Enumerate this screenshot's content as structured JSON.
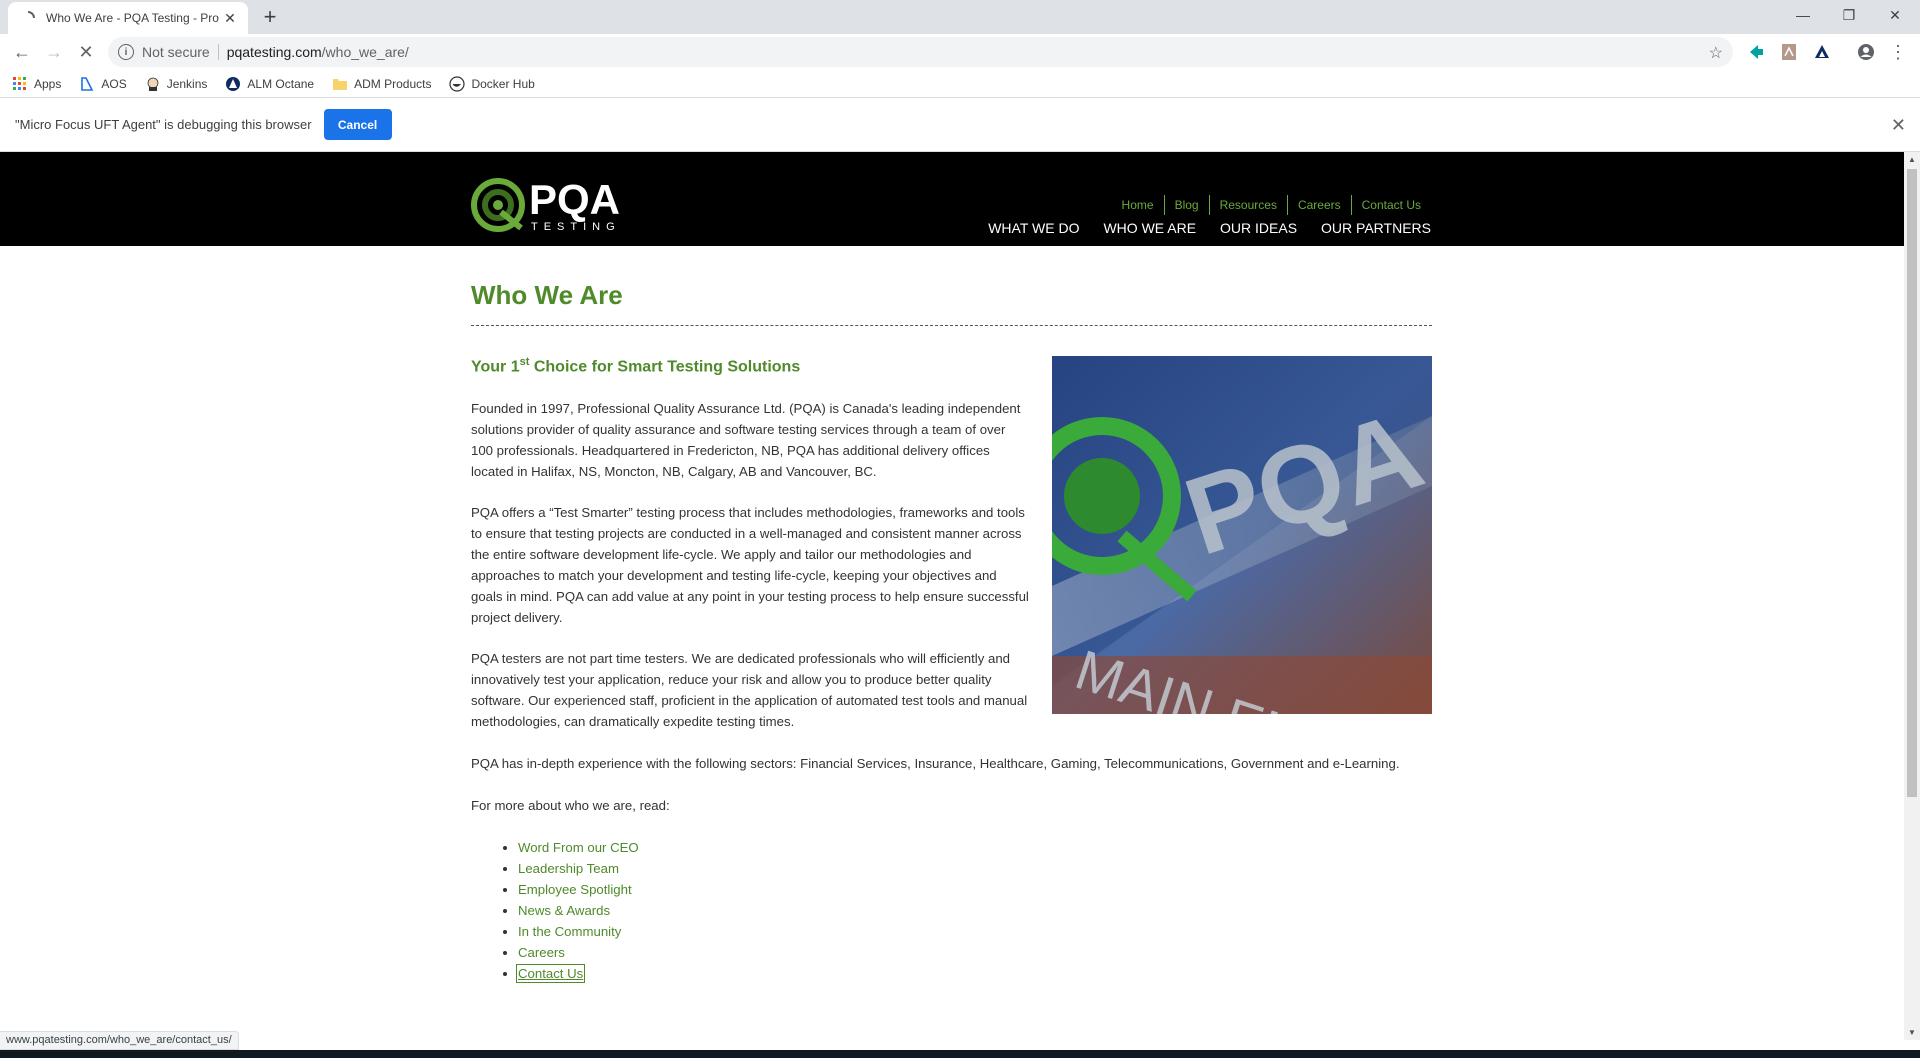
{
  "browser": {
    "tab_title": "Who We Are - PQA Testing - Pro",
    "security_label": "Not secure",
    "url_host": "pqatesting.com",
    "url_path": "/who_we_are/",
    "bookmarks": [
      {
        "label": "Apps",
        "icon": "apps-grid-icon"
      },
      {
        "label": "AOS",
        "icon": "aos-icon"
      },
      {
        "label": "Jenkins",
        "icon": "jenkins-icon"
      },
      {
        "label": "ALM Octane",
        "icon": "alm-octane-icon"
      },
      {
        "label": "ADM Products",
        "icon": "folder-icon"
      },
      {
        "label": "Docker Hub",
        "icon": "docker-icon"
      }
    ],
    "infobar_message": "\"Micro Focus UFT Agent\" is debugging this browser",
    "infobar_cancel": "Cancel",
    "status_url": "www.pqatesting.com/who_we_are/contact_us/"
  },
  "site": {
    "logo_text": "PQA",
    "logo_subtext": "TESTING",
    "util_nav": [
      "Home",
      "Blog",
      "Resources",
      "Careers",
      "Contact Us"
    ],
    "main_nav": [
      "WHAT WE DO",
      "WHO WE ARE",
      "OUR IDEAS",
      "OUR PARTNERS"
    ],
    "accent_color": "#4f8a2b"
  },
  "content": {
    "title": "Who We Are",
    "subtitle_pre": "Your 1",
    "subtitle_sup": "st",
    "subtitle_post": " Choice for Smart Testing Solutions",
    "paragraphs": [
      "Founded in 1997, Professional Quality Assurance Ltd. (PQA) is Canada's leading independent solutions provider of quality assurance and software testing services through a team of over 100 professionals. Headquartered in Fredericton, NB, PQA has additional delivery offices located in Halifax, NS, Moncton, NB, Calgary, AB and Vancouver, BC.",
      "PQA offers a “Test Smarter” testing process that includes methodologies, frameworks and tools to ensure that testing projects are conducted in a well-managed and consistent manner across the entire software development life-cycle. We apply and tailor our methodologies and approaches to match your development and testing life-cycle, keeping your objectives and goals in mind. PQA can add value at any point in your testing process to help ensure successful project delivery.",
      "PQA testers are not part time testers. We are dedicated professionals who will efficiently and innovatively test your application, reduce your risk and allow you to produce better quality software. Our experienced staff, proficient in the application of automated test tools and manual methodologies, can dramatically expedite testing times."
    ],
    "sectors": "PQA has in-depth experience with the following sectors: Financial Services, Insurance, Healthcare, Gaming, Telecommunications, Government and e-Learning.",
    "read_more": "For more about who we are, read:",
    "links": [
      "Word From our CEO",
      "Leadership Team",
      "Employee Spotlight",
      "News & Awards",
      "In the Community",
      "Careers",
      "Contact Us"
    ],
    "hero_image_text": [
      "PQA",
      "MAIN ENTRA"
    ]
  }
}
